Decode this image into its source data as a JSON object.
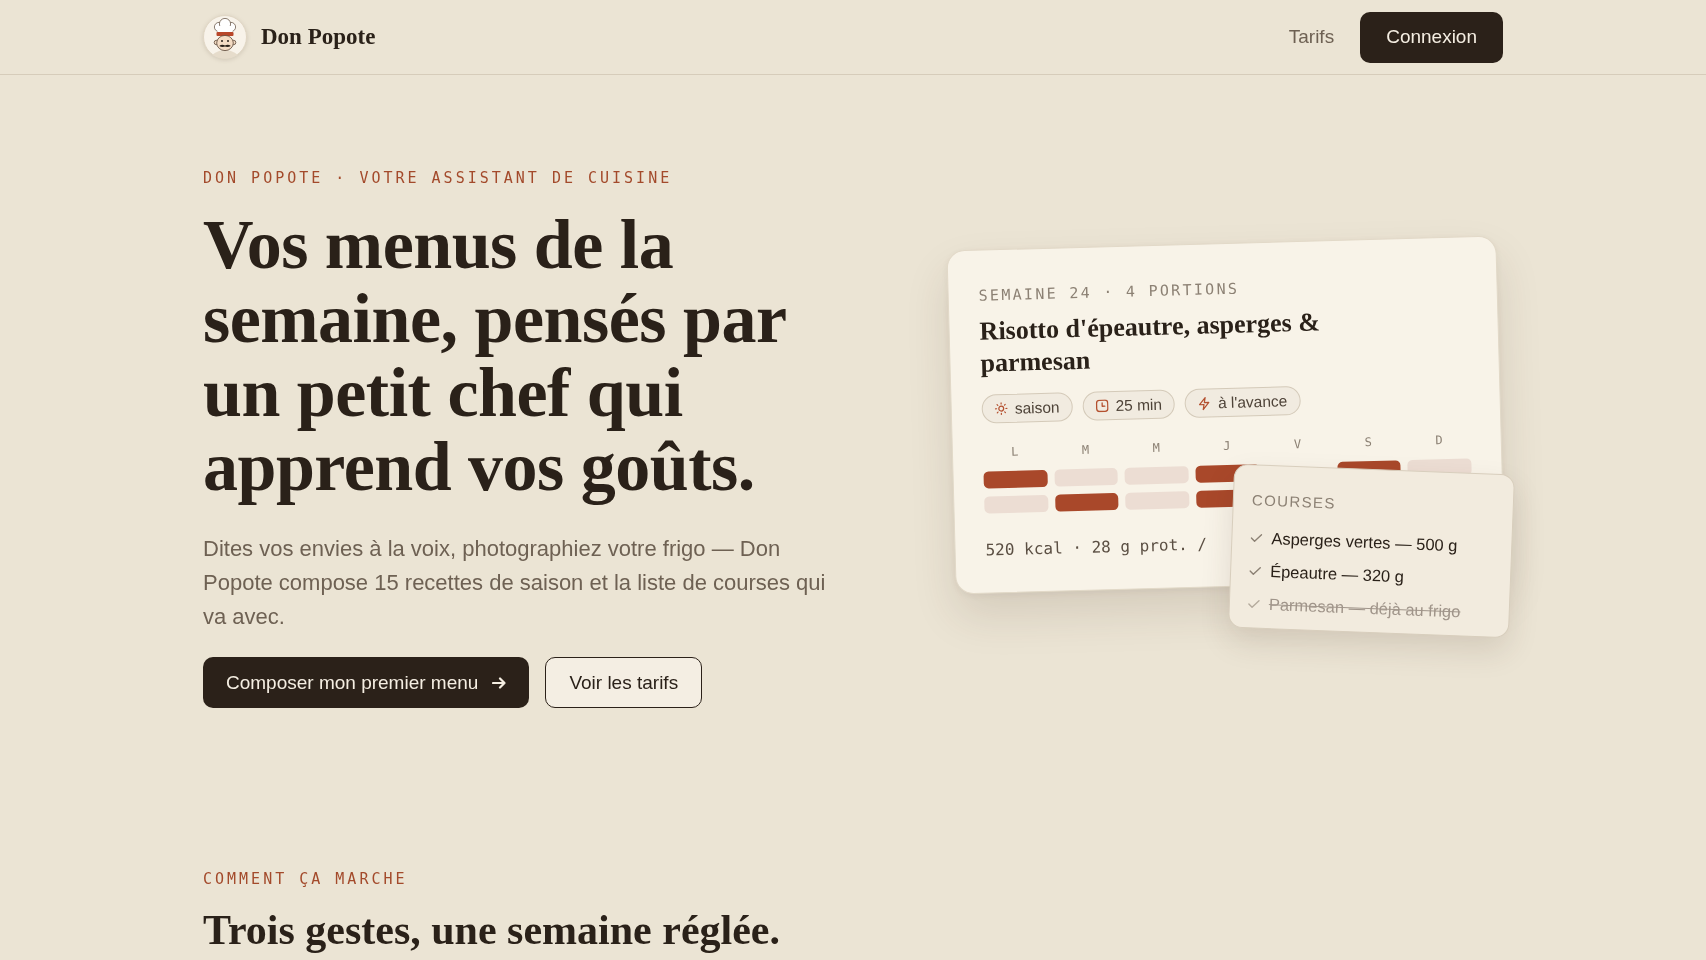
{
  "header": {
    "brand": "Don Popote",
    "nav": [
      {
        "label": "Tarifs",
        "kind": "link"
      },
      {
        "label": "Connexion",
        "kind": "button"
      }
    ]
  },
  "hero": {
    "eyebrow": "DON POPOTE · VOTRE ASSISTANT DE CUISINE",
    "title": "Vos menus de la semaine, pensés par un petit chef qui apprend vos goûts.",
    "description": "Dites vos envies à la voix, photographiez votre frigo — Don Popote compose 15 recettes de saison et la liste de courses qui va avec.",
    "actions": [
      {
        "label": "Composer mon premier menu",
        "kind": "primary"
      },
      {
        "label": "Voir les tarifs",
        "kind": "secondary"
      }
    ]
  },
  "menu_card": {
    "meta": "SEMAINE 24 · 4 PORTIONS",
    "recipe": "Risotto d'épeautre, asperges & parmesan",
    "tags": [
      {
        "label": "saison",
        "kind": "season"
      },
      {
        "label": "25 min",
        "kind": "time"
      },
      {
        "label": "à l'avance",
        "kind": "prep"
      }
    ],
    "days": [
      {
        "label": "L",
        "meals": [
          {
            "planned": true
          },
          {
            "planned": false
          }
        ]
      },
      {
        "label": "M",
        "meals": [
          {
            "planned": false
          },
          {
            "planned": true
          }
        ]
      },
      {
        "label": "M",
        "meals": [
          {
            "planned": false
          },
          {
            "planned": false
          }
        ]
      },
      {
        "label": "J",
        "meals": [
          {
            "planned": true
          },
          {
            "planned": true
          }
        ]
      },
      {
        "label": "V"
      },
      {
        "label": "S",
        "meals": [
          {
            "planned": true
          }
        ]
      },
      {
        "label": "D",
        "meals": [
          {
            "planned": false
          }
        ]
      }
    ],
    "nutrition": "520 kcal · 28 g prot. /"
  },
  "shopping_card": {
    "title": "COURSES",
    "items": [
      {
        "label": "Asperges vertes — 500 g",
        "crossed_out": false
      },
      {
        "label": "Épeautre — 320 g",
        "crossed_out": false
      },
      {
        "label": "Parmesan — déjà au frigo",
        "crossed_out": true
      }
    ]
  },
  "how_it_works": {
    "eyebrow": "COMMENT ÇA MARCHE",
    "title": "Trois gestes, une semaine réglée."
  }
}
